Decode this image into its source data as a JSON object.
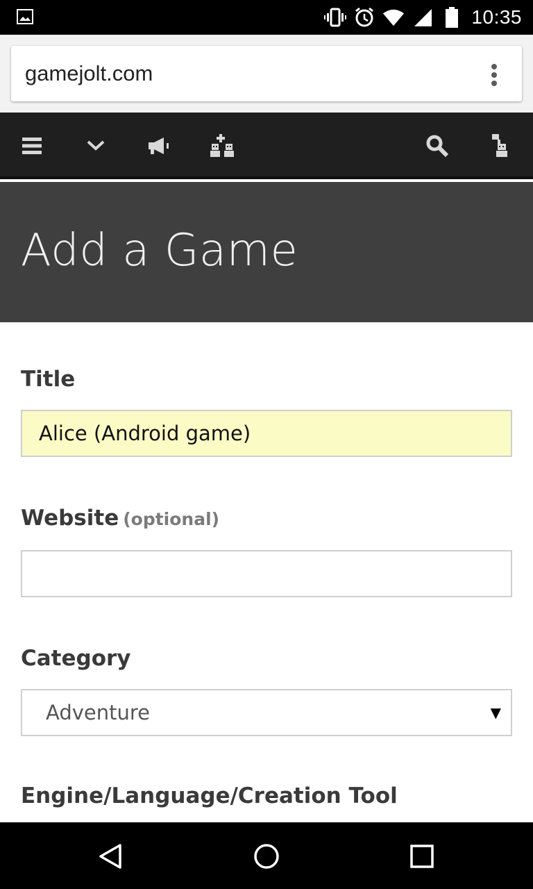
{
  "status_bar": {
    "time": "10:35",
    "icons": [
      "image-icon",
      "vibrate-icon",
      "alarm-icon",
      "wifi-icon",
      "signal-icon",
      "battery-icon"
    ]
  },
  "browser": {
    "url": "gamejolt.com",
    "menu_icon": "more-vert-icon"
  },
  "site_nav": {
    "icons": [
      "menu-icon",
      "chevron-down-icon",
      "megaphone-icon",
      "users-add-icon",
      "search-icon",
      "user-icon"
    ]
  },
  "page": {
    "title": "Add a Game"
  },
  "form": {
    "title_label": "Title",
    "title_value": "Alice (Android game)",
    "website_label": "Website",
    "website_optional": "(optional)",
    "website_value": "",
    "category_label": "Category",
    "category_value": "Adventure",
    "engine_label": "Engine/Language/Creation Tool"
  },
  "colors": {
    "nav_bg": "#1f1f1f",
    "header_bg": "#3f3f3f",
    "filled_input_bg": "#fbfbc6"
  },
  "android_nav": {
    "icons": [
      "back-icon",
      "home-icon",
      "recents-icon"
    ]
  }
}
